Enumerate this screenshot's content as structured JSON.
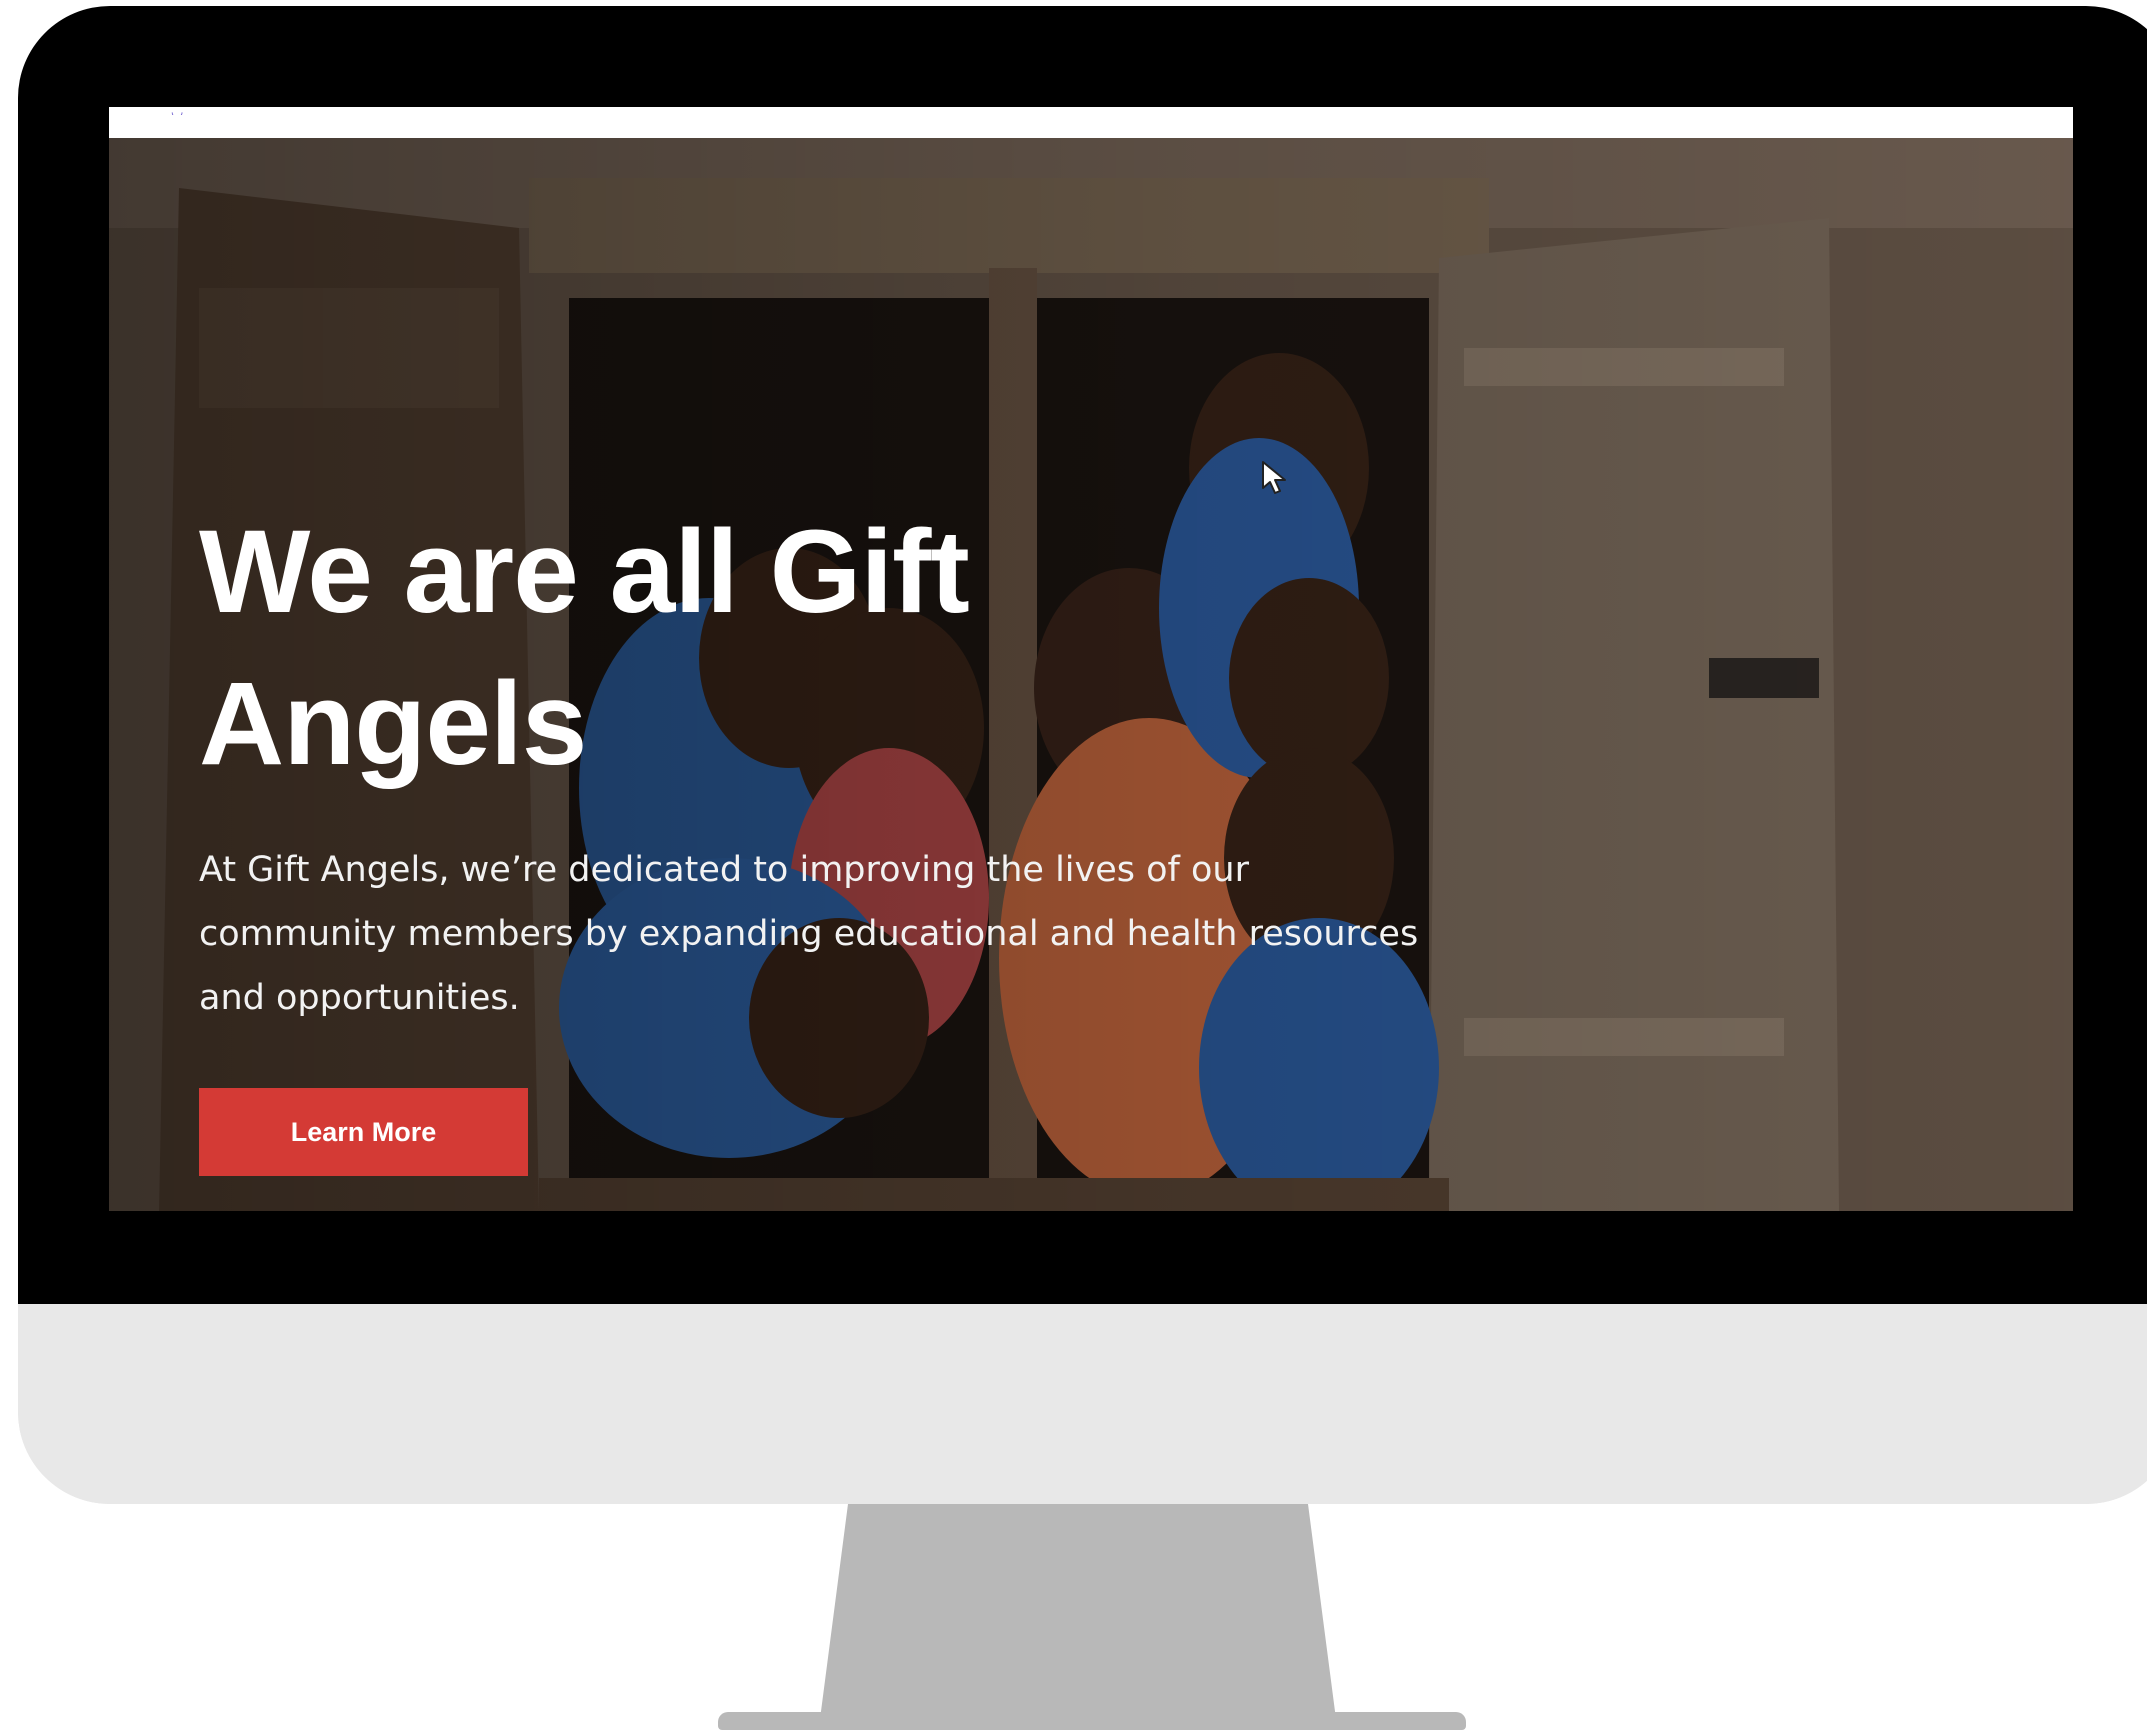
{
  "hero": {
    "title_line1": "We are all Gift",
    "title_line2": "Angels",
    "description": "At Gift Angels, we’re dedicated to improving the lives of our community members by expanding educational and health resources and opportunities.",
    "cta_label": "Learn More"
  },
  "colors": {
    "cta_background": "#d43a35",
    "bezel": "#000000",
    "monitor_chin": "#e8e8e8",
    "stand": "#b8b8b8"
  },
  "icons": {
    "cursor": "mouse-pointer-icon"
  }
}
